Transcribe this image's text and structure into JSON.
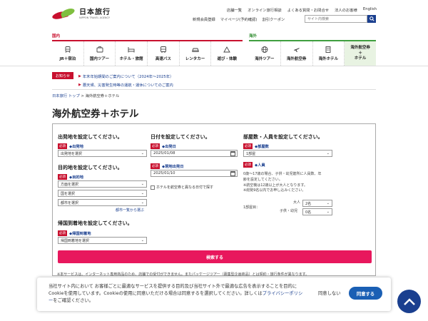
{
  "logo": {
    "jp": "日本旅行",
    "en": "NIPPON TRAVEL AGENCY"
  },
  "header": {
    "top_links": [
      "店舗一覧",
      "オンライン旅行相談",
      "よくある質問・お問合せ",
      "法人のお客様",
      "English"
    ],
    "sub_links": [
      "新規会員登録",
      "マイページ(予約確認)",
      "割引クーポン"
    ],
    "search_placeholder": "サイト内検索"
  },
  "nav": {
    "domestic_label": "国内",
    "international_label": "海外",
    "domestic_items": [
      {
        "label": "JR＋宿泊",
        "icon": "train-icon"
      },
      {
        "label": "国内ツアー",
        "icon": "tour-icon"
      },
      {
        "label": "ホテル・旅館",
        "icon": "hotel-icon"
      },
      {
        "label": "高速バス",
        "icon": "bus-icon"
      },
      {
        "label": "レンタカー",
        "icon": "car-icon"
      },
      {
        "label": "遊び・体験",
        "icon": "activity-icon"
      }
    ],
    "international_items": [
      {
        "label": "海外ツアー",
        "icon": "globe-icon"
      },
      {
        "label": "海外航空券",
        "icon": "plane-icon"
      },
      {
        "label": "海外ホテル",
        "icon": "building-icon"
      },
      {
        "label_line1": "海外航空券",
        "label_line2": "＋",
        "label_line3": "ホテル"
      }
    ]
  },
  "notices": {
    "badge": "お知らせ",
    "items": [
      "年末年始期間のご案内について（2024年～2025年）",
      "悪天候、災害発生時等の運航・運休についてのご案内"
    ]
  },
  "breadcrumb": {
    "home": "日本旅行 トップ",
    "sep": " > ",
    "current": "海外航空券＋ホテル"
  },
  "page_title": "海外航空券＋ホテル",
  "form": {
    "required_label": "必須",
    "departure": {
      "title": "出発地を設定してください。",
      "field_label": "◆出発地",
      "value": "出発地を選択"
    },
    "destination": {
      "title": "目的地を設定してください。",
      "field_label": "◆目的地",
      "direction": "方面を選択",
      "country": "国を選択",
      "city": "都市を選択",
      "city_list_link": "都市一覧から選ぶ"
    },
    "return_arrival": {
      "title": "帰国到着地を設定してください。",
      "field_label": "◆帰国到着地",
      "value": "帰国到着地を選択"
    },
    "dates": {
      "title": "日付を設定してください。",
      "departure_label": "◆出発日",
      "departure_value": "2025/01/08",
      "local_label": "◆現地出発日",
      "local_value": "2025/01/10",
      "checkbox_label": "ホテルを航空券と異なる日付で探す"
    },
    "rooms": {
      "title": "部屋数・人員を設定してください。",
      "rooms_label": "◆部屋数",
      "rooms_value": "1部屋",
      "people_label": "◆人員",
      "note_line1": "0歳～17歳の場合、子供・幼児筋所に人員数、年",
      "note_line2": "齢を設定してください。",
      "note_line3": "※航空機は12歳以上が大人となります。",
      "note_line4": "※総勢9名以内でお申し込みください。",
      "room_label": "1部屋目：",
      "adult_label": "大人",
      "adult_value": "2名",
      "child_label": "子供・幼児",
      "child_value": "0名"
    },
    "search_button": "検索する"
  },
  "footer_note": "※本サービスは、インターネット専用商品のため、店舗での受付ができません。またパッケージツアー（募集型企画商品）とは契約・旅行条件が異なります。",
  "cookie": {
    "text_before": "当社サイト内において お客様ごとに最適なサービスを提供する目的及び当社サイト外で最適な広告を表示することを目的にCookieを使用しています。Cookieの使用に同意いただける場合は同意するを選択してください。詳しくは",
    "policy_link": "プライバシーポリシー",
    "text_after": "をご確認ください。",
    "decline": "同意しない",
    "accept": "同意する"
  },
  "colors": {
    "brand_red": "#c8102e",
    "intl_green": "#3f9f3f",
    "navy": "#1a3f8f",
    "search_pink": "#e8175d"
  }
}
